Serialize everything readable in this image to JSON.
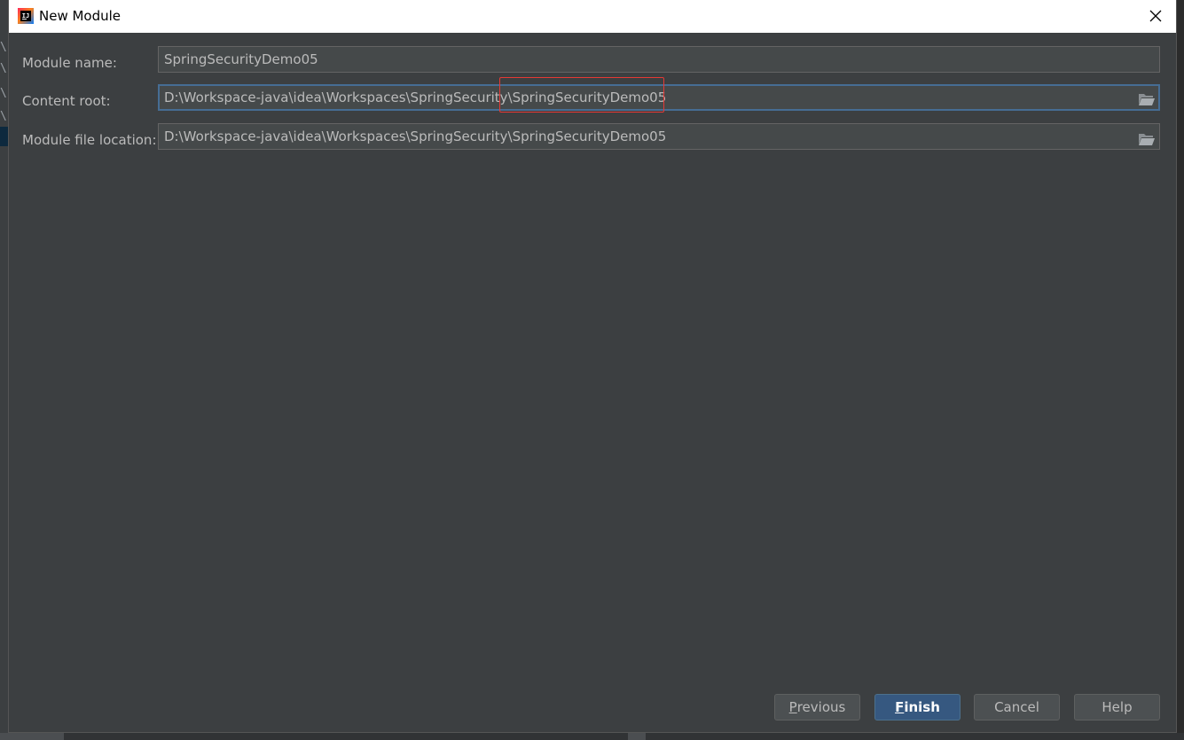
{
  "window": {
    "title": "New Module",
    "close_icon": "close-icon"
  },
  "form": {
    "module_name": {
      "label": "Module name:",
      "value": "SpringSecurityDemo05"
    },
    "content_root": {
      "label": "Content root:",
      "value": "D:\\Workspace-java\\idea\\Workspaces\\SpringSecurity\\SpringSecurityDemo05",
      "browse_icon": "folder-open-icon"
    },
    "module_file_location": {
      "label": "Module file location:",
      "value": "D:\\Workspace-java\\idea\\Workspaces\\SpringSecurity\\SpringSecurityDemo05",
      "browse_icon": "folder-open-icon"
    }
  },
  "buttons": {
    "previous": {
      "mnemonic": "P",
      "rest": "revious"
    },
    "finish": {
      "mnemonic": "F",
      "rest": "inish"
    },
    "cancel": "Cancel",
    "help": "Help"
  },
  "background": {
    "glyph": "\\"
  },
  "colors": {
    "dialog_bg": "#3c3f41",
    "field_bg": "#45494a",
    "focus_border": "#466d94",
    "primary_button": "#365880",
    "highlight_annotation": "#e53935"
  }
}
